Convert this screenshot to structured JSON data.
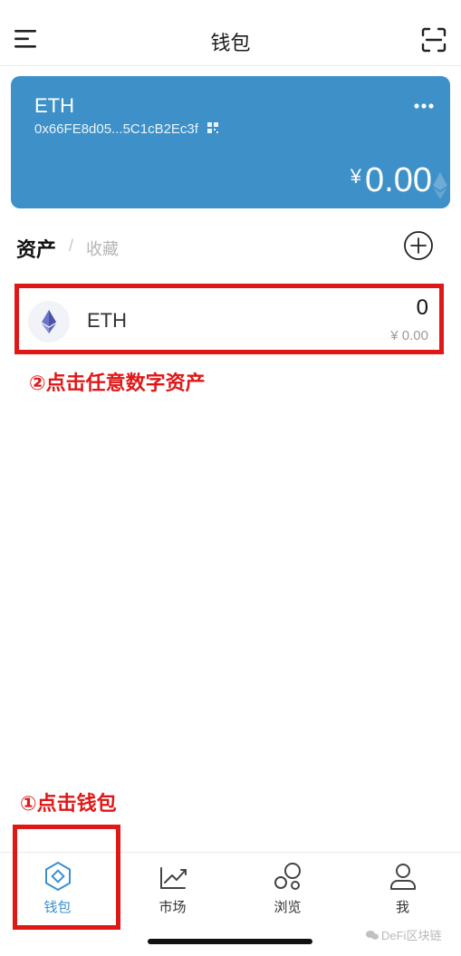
{
  "header": {
    "title": "钱包",
    "menu_icon": "menu-icon",
    "scan_icon": "scan-icon"
  },
  "wallet_card": {
    "name": "ETH",
    "address": "0x66FE8d05...5C1cB2Ec3f",
    "currency_symbol": "¥",
    "balance": "0.00",
    "accent_color": "#3e90c8"
  },
  "asset_tabs": {
    "assets": "资产",
    "separator": "/",
    "favorites": "收藏"
  },
  "assets": [
    {
      "name": "ETH",
      "amount": "0",
      "value": "¥ 0.00"
    }
  ],
  "annotations": {
    "step2": "②点击任意数字资产",
    "step1": "①点击钱包",
    "color": "#e01717"
  },
  "tabbar": {
    "items": [
      {
        "label": "钱包",
        "icon": "wallet-icon",
        "active": true
      },
      {
        "label": "市场",
        "icon": "market-icon",
        "active": false
      },
      {
        "label": "浏览",
        "icon": "browse-icon",
        "active": false
      },
      {
        "label": "我",
        "icon": "profile-icon",
        "active": false
      }
    ],
    "active_color": "#3b8fd0"
  },
  "watermark": "DeFi区块链"
}
